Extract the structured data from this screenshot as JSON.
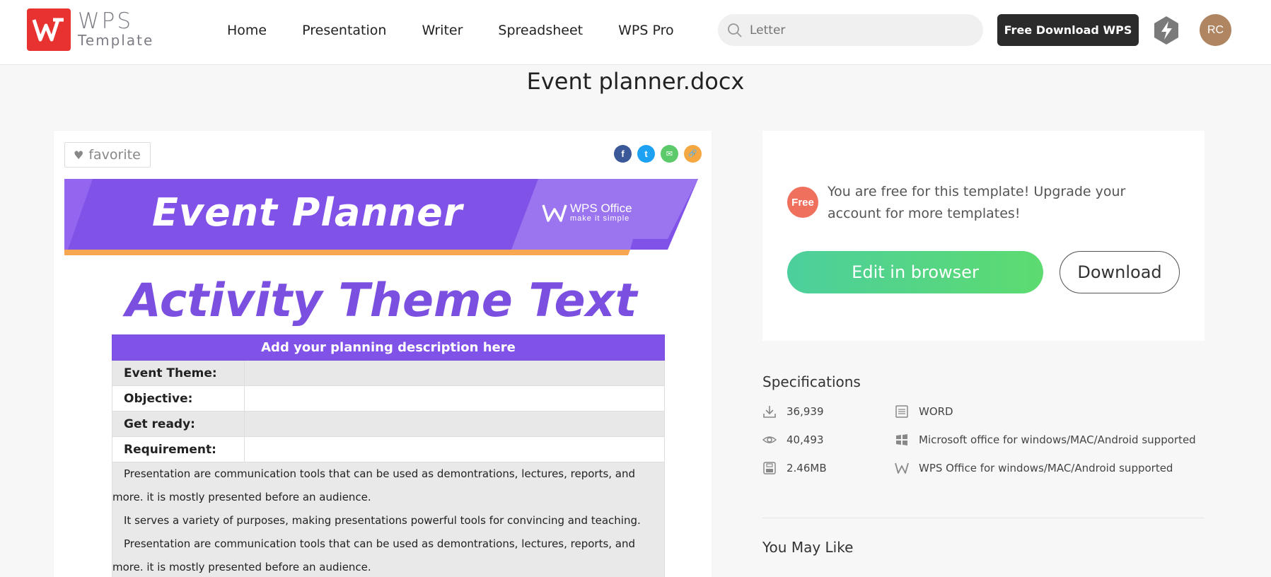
{
  "header": {
    "logo": {
      "line1": "WPS",
      "line2": "Template"
    },
    "nav": [
      "Home",
      "Presentation",
      "Writer",
      "Spreadsheet",
      "WPS Pro"
    ],
    "search": {
      "placeholder": "Letter"
    },
    "download_label": "Free Download WPS",
    "avatar_initials": "RC"
  },
  "page_title": "Event planner.docx",
  "preview": {
    "favorite_label": "favorite",
    "share": [
      {
        "name": "facebook",
        "glyph": "f",
        "color": "#3b5998"
      },
      {
        "name": "twitter",
        "glyph": "t",
        "color": "#1da1f2"
      },
      {
        "name": "email",
        "glyph": "✉",
        "color": "#5cc96b"
      },
      {
        "name": "link",
        "glyph": "🔗",
        "color": "#f5a742"
      }
    ],
    "doc": {
      "banner_title": "Event Planner",
      "banner_logo_line1": "WPS Office",
      "banner_logo_line2": "make it simple",
      "theme_text": "Activity Theme Text",
      "table_header": "Add your planning description here",
      "rows": [
        "Event Theme:",
        "Objective:",
        "Get ready:",
        "Requirement:"
      ],
      "paragraphs": [
        "Presentation are communication tools that can be used as demontrations, lectures, reports, and more. it is mostly presented before an audience.",
        "It serves a variety of purposes, making presentations powerful tools for convincing and teaching.",
        "Presentation are communication tools that can be used as demontrations, lectures, reports, and more. it is mostly presented before an audience."
      ]
    }
  },
  "info": {
    "badge": "Free",
    "message": "You are free for this template! Upgrade your account for more templates!",
    "edit_label": "Edit in browser",
    "download_label": "Download"
  },
  "specs": {
    "title": "Specifications",
    "downloads": "36,939",
    "views": "40,493",
    "size": "2.46MB",
    "format": "WORD",
    "ms_support": "Microsoft office for windows/MAC/Android supported",
    "wps_support": "WPS Office for windows/MAC/Android supported"
  },
  "you_may_like": "You May Like"
}
